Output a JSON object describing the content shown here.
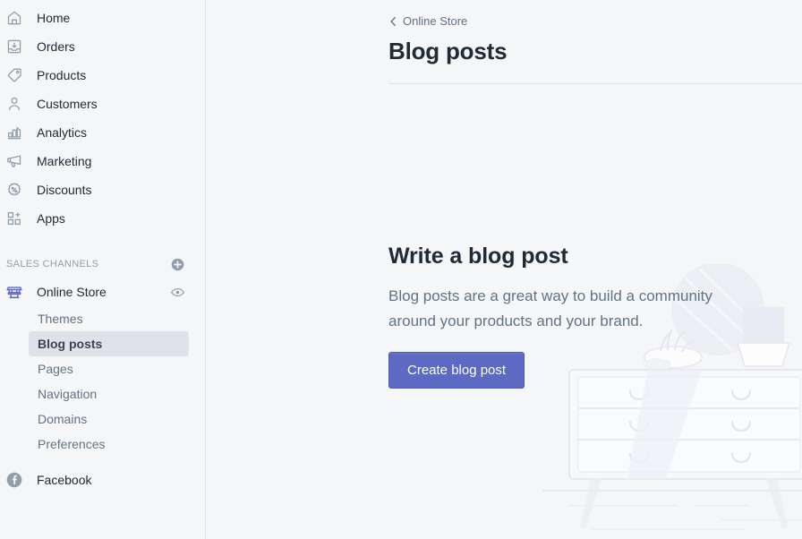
{
  "sidebar": {
    "nav_items": [
      {
        "label": "Home",
        "icon": "home-icon"
      },
      {
        "label": "Orders",
        "icon": "orders-icon"
      },
      {
        "label": "Products",
        "icon": "tag-icon"
      },
      {
        "label": "Customers",
        "icon": "person-icon"
      },
      {
        "label": "Analytics",
        "icon": "bar-chart-icon"
      },
      {
        "label": "Marketing",
        "icon": "megaphone-icon"
      },
      {
        "label": "Discounts",
        "icon": "percent-badge-icon"
      },
      {
        "label": "Apps",
        "icon": "apps-grid-plus-icon"
      }
    ],
    "section": {
      "title": "SALES CHANNELS",
      "add_icon": "plus-circle-icon"
    },
    "channel": {
      "label": "Online Store",
      "icon": "storefront-icon",
      "view_icon": "eye-icon"
    },
    "subnav_items": [
      {
        "label": "Themes",
        "active": false
      },
      {
        "label": "Blog posts",
        "active": true
      },
      {
        "label": "Pages",
        "active": false
      },
      {
        "label": "Navigation",
        "active": false
      },
      {
        "label": "Domains",
        "active": false
      },
      {
        "label": "Preferences",
        "active": false
      }
    ],
    "facebook": {
      "label": "Facebook",
      "icon": "facebook-icon"
    }
  },
  "header": {
    "breadcrumb_label": "Online Store",
    "breadcrumb_icon": "chevron-left-icon",
    "title": "Blog posts"
  },
  "empty_state": {
    "title": "Write a blog post",
    "body": "Blog posts are a great way to build a community around your products and your brand.",
    "button_label": "Create blog post",
    "illustration": "sideboard-dresser-illustration"
  },
  "colors": {
    "accent": "#5c6ac4",
    "background": "#f4f6f8",
    "active_item_bg": "#dfe3e8",
    "text": "#212b36",
    "muted_text": "#637381",
    "icon": "#919eab",
    "border": "#dfe3e8"
  }
}
